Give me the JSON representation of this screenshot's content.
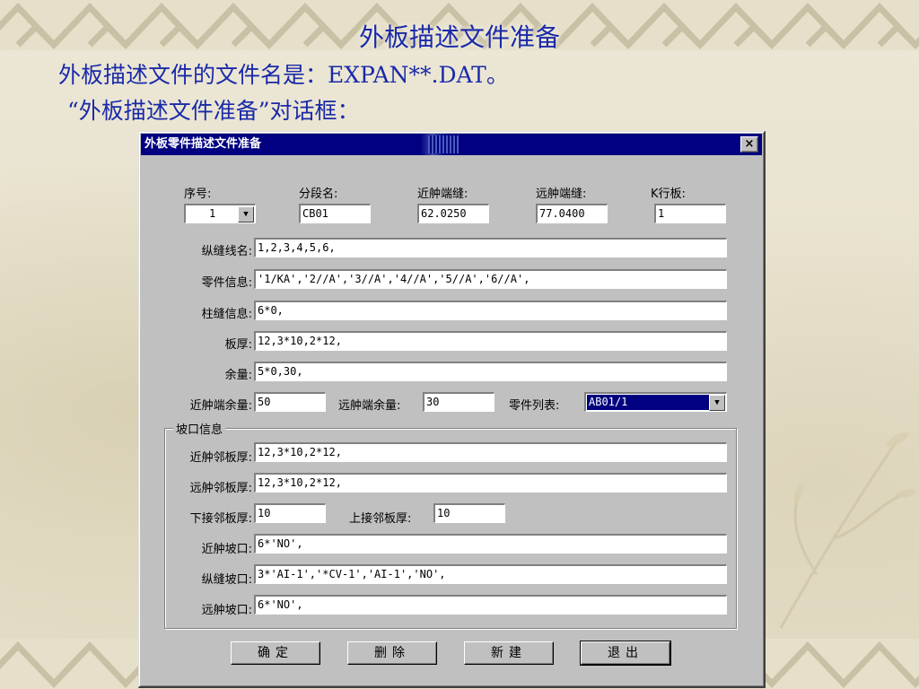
{
  "slide": {
    "title": "外板描述文件准备",
    "line1": "外板描述文件的文件名是：EXPAN**.DAT。",
    "line2": "“外板描述文件准备”对话框："
  },
  "dialog": {
    "title": "外板零件描述文件准备",
    "close": "×",
    "top_labels": {
      "seq": "序号:",
      "segment": "分段名:",
      "near_seam": "近舯端缝:",
      "far_seam": "远舯端缝:",
      "k_row": "K行板:"
    },
    "top_values": {
      "seq": "1",
      "segment": "CB01",
      "near_seam": "62.0250",
      "far_seam": "77.0400",
      "k_row": "1"
    },
    "rows": {
      "long_seam_label": "纵缝线名:",
      "long_seam_value": "1,2,3,4,5,6,",
      "part_info_label": "零件信息:",
      "part_info_value": "'1/KA','2//A','3//A','4//A','5//A','6//A',",
      "col_seam_label": "柱缝信息:",
      "col_seam_value": "6*0,",
      "thickness_label": "板厚:",
      "thickness_value": "12,3*10,2*12,",
      "margin_label": "余量:",
      "margin_value": "5*0,30,"
    },
    "margins": {
      "near_label": "近舯端余量:",
      "near_value": "50",
      "far_label": "远舯端余量:",
      "far_value": "30",
      "part_list_label": "零件列表:",
      "part_list_value": "AB01/1"
    },
    "bevel": {
      "group_title": "坡口信息",
      "near_adj_label": "近舯邻板厚:",
      "near_adj_value": "12,3*10,2*12,",
      "far_adj_label": "远舯邻板厚:",
      "far_adj_value": "12,3*10,2*12,",
      "lower_adj_label": "下接邻板厚:",
      "lower_adj_value": "10",
      "upper_adj_label": "上接邻板厚:",
      "upper_adj_value": "10",
      "near_bevel_label": "近舯坡口:",
      "near_bevel_value": "6*'NO',",
      "long_bevel_label": "纵缝坡口:",
      "long_bevel_value": "3*'AI-1','*CV-1','AI-1','NO',",
      "far_bevel_label": "远舯坡口:",
      "far_bevel_value": "6*'NO',"
    },
    "buttons": {
      "ok": "确定",
      "delete": "删除",
      "new": "新建",
      "exit": "退出"
    }
  },
  "colors": {
    "title_text": "#1a2aa8",
    "titlebar": "#000080",
    "dialog_bg": "#c0c0c0",
    "background": "#e9e3cf"
  }
}
